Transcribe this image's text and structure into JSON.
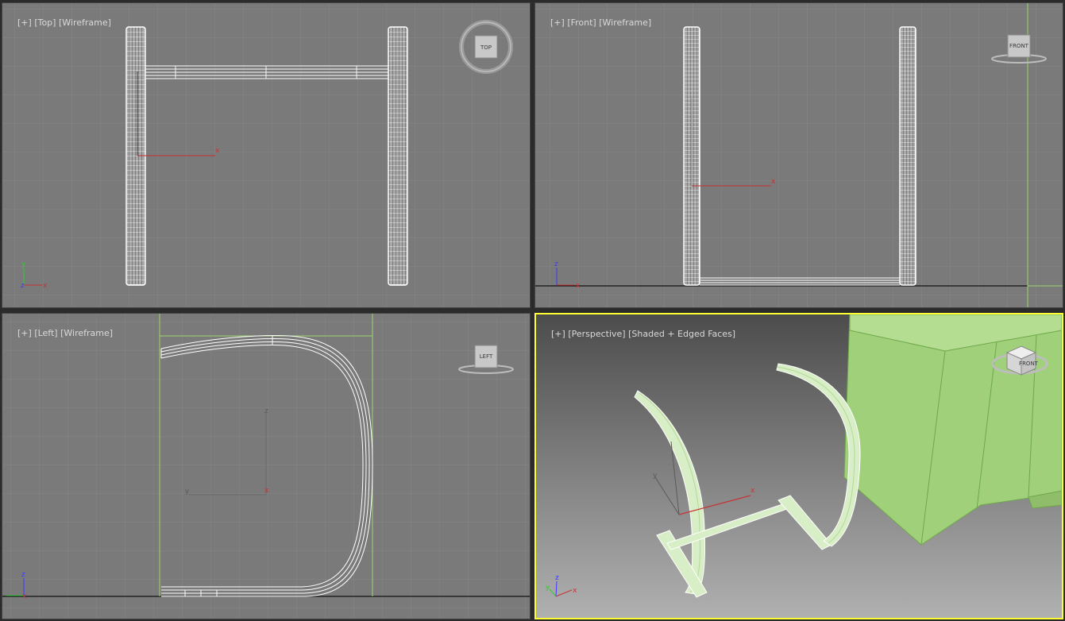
{
  "viewports": [
    {
      "id": "top",
      "menu": "[+]",
      "view": "[Top]",
      "mode": "[Wireframe]",
      "cube": "TOP",
      "axes": [
        "x",
        "y",
        "z"
      ]
    },
    {
      "id": "front",
      "menu": "[+]",
      "view": "[Front]",
      "mode": "[Wireframe]",
      "cube": "FRONT",
      "axes": [
        "x",
        "z"
      ]
    },
    {
      "id": "left",
      "menu": "[+]",
      "view": "[Left]",
      "mode": "[Wireframe]",
      "cube": "LEFT",
      "axes": [
        "y",
        "z",
        "x"
      ]
    },
    {
      "id": "perspective",
      "menu": "[+]",
      "view": "[Perspective]",
      "mode": "[Shaded + Edged Faces]",
      "cube": "FRONT",
      "axes": [
        "x",
        "y",
        "z"
      ]
    }
  ],
  "colors": {
    "viewport_bg": "#7a7a7a",
    "grid": "#868686",
    "wire": "#ffffff",
    "active_border": "#ffff33",
    "selection": "#9dd46e",
    "gizmo_x": "#c83232",
    "horizon": "#111111"
  }
}
